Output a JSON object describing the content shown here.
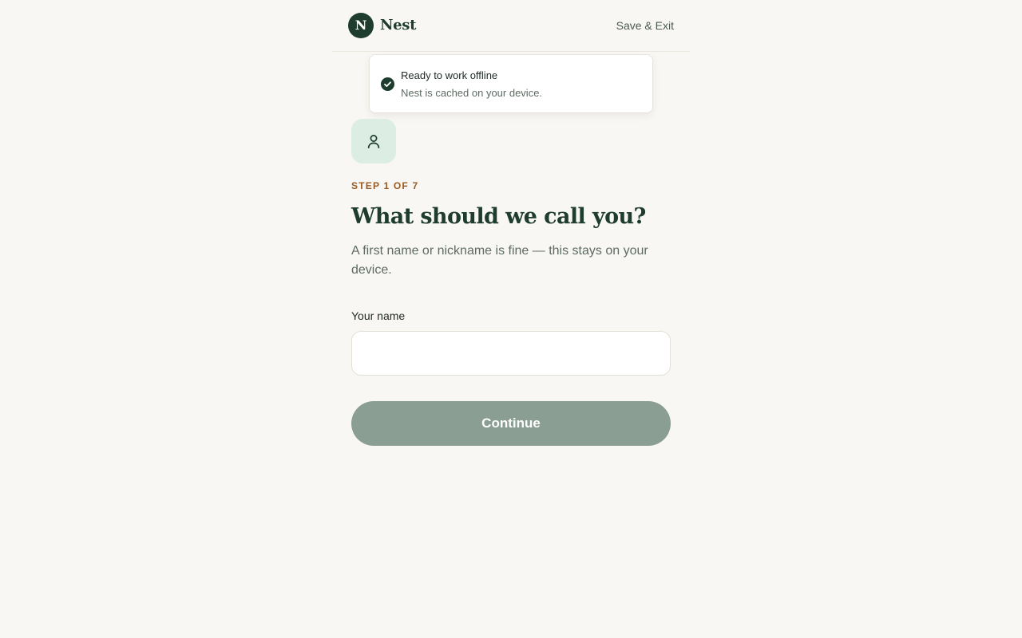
{
  "header": {
    "logo_letter": "N",
    "brand_name": "Nest",
    "save_exit_label": "Save & Exit"
  },
  "toast": {
    "icon": "check-circle-icon",
    "title": "Ready to work offline",
    "message": "Nest is cached on your device."
  },
  "step": {
    "icon": "user-icon",
    "label": "STEP 1 OF 7",
    "current": 1,
    "total": 7
  },
  "form": {
    "title": "What should we call you?",
    "subtitle": "A first name or nickname is fine — this stays on your device.",
    "name_label": "Your name",
    "name_value": "",
    "name_placeholder": "",
    "continue_label": "Continue",
    "continue_enabled": false
  },
  "colors": {
    "brand": "#1e3d2f",
    "accent_step": "#9a5a22",
    "icon_tile": "#dcede4",
    "button_disabled": "#8a9e93",
    "background": "#f9f7f3"
  }
}
